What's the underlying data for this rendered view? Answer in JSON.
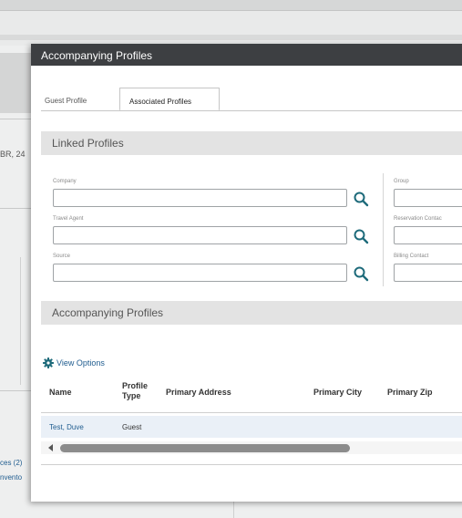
{
  "background": {
    "partial_text": "BR, 24",
    "links": [
      "ces (2)",
      "nvento"
    ]
  },
  "modal": {
    "title": "Accompanying Profiles",
    "tabs": [
      {
        "label": "Guest Profile",
        "active": false
      },
      {
        "label": "Associated Profiles",
        "active": true
      }
    ],
    "linked_section": {
      "title": "Linked Profiles",
      "left_fields": [
        {
          "label": "Company",
          "value": ""
        },
        {
          "label": "Travel Agent",
          "value": ""
        },
        {
          "label": "Source",
          "value": ""
        }
      ],
      "right_fields": [
        {
          "label": "Group",
          "value": ""
        },
        {
          "label": "Reservation Contac",
          "value": ""
        },
        {
          "label": "Billing Contact",
          "value": ""
        }
      ]
    },
    "accompanying_section": {
      "title": "Accompanying Profiles",
      "view_options": "View Options",
      "columns": [
        "Name",
        "Profile Type",
        "Primary Address",
        "Primary City",
        "Primary Zip"
      ],
      "rows": [
        {
          "name": "Test, Duve",
          "profile_type": "Guest",
          "primary_address": "",
          "primary_city": "",
          "primary_zip": ""
        }
      ]
    }
  },
  "colors": {
    "header": "#3d3f42",
    "link": "#1f5c8f",
    "section_bar": "#e3e3e3",
    "icon_teal": "#1d6a7a",
    "row_selected": "#eaf0f7"
  },
  "icons": [
    "search-icon",
    "gear-icon",
    "scroll-left-icon"
  ]
}
